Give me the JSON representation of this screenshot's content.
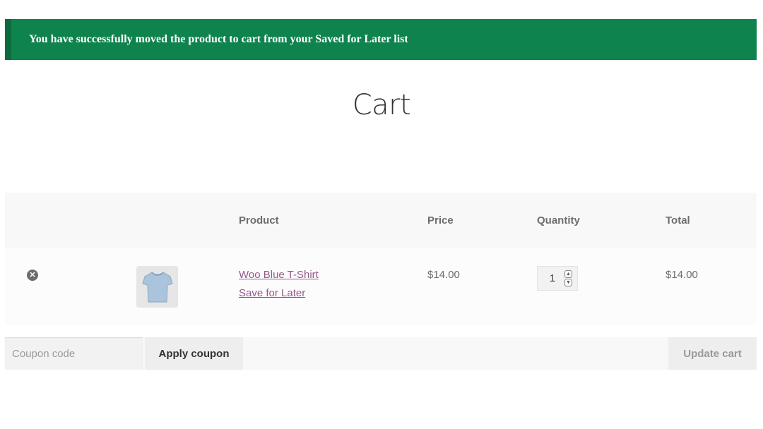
{
  "notice": {
    "message": "You have successfully moved the product to cart from your Saved for Later list"
  },
  "page": {
    "title": "Cart"
  },
  "table": {
    "headers": {
      "product": "Product",
      "price": "Price",
      "quantity": "Quantity",
      "total": "Total"
    },
    "items": [
      {
        "remove_icon": "close-circle-icon",
        "thumbnail_icon": "tshirt-icon",
        "name": "Woo Blue T-Shirt",
        "save_for_later": "Save for Later",
        "price": "$14.00",
        "quantity": "1",
        "total": "$14.00"
      }
    ]
  },
  "actions": {
    "coupon_placeholder": "Coupon code",
    "apply_label": "Apply coupon",
    "update_label": "Update cart"
  },
  "colors": {
    "notice_bg": "#0f834d",
    "link": "#96588a"
  }
}
